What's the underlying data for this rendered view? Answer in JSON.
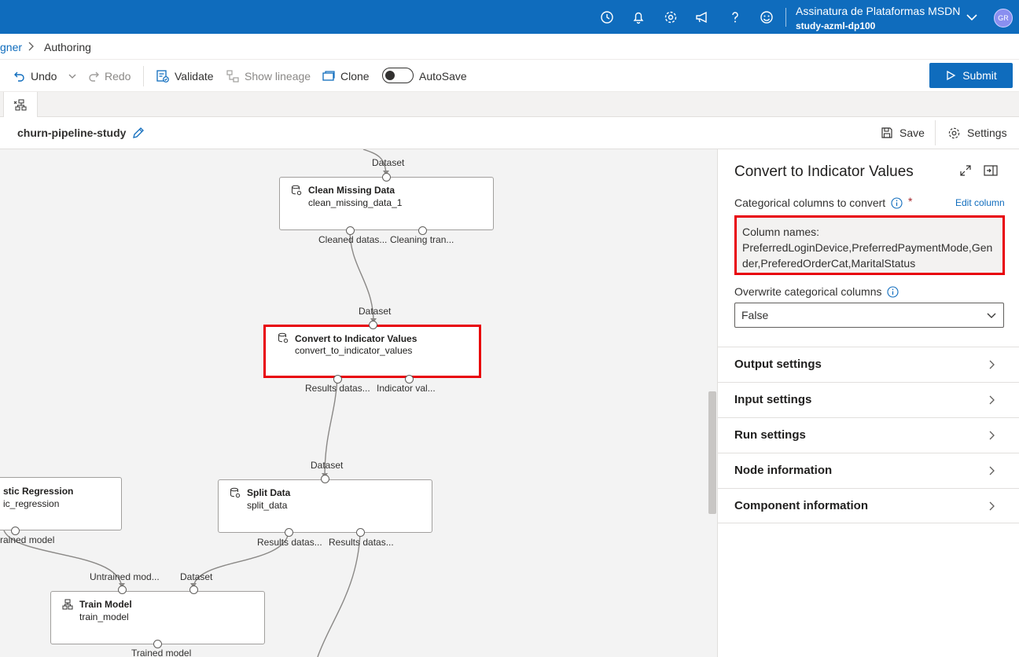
{
  "topbar": {
    "icons": [
      "history-icon",
      "bell-icon",
      "gear-icon",
      "feedback-icon",
      "help-icon",
      "smiley-icon"
    ],
    "account_name": "Assinatura de Plataformas MSDN",
    "workspace": "study-azml-dp100",
    "avatar_initials": "GR",
    "accent": "#0f6cbd"
  },
  "breadcrumb": {
    "parent": "gner",
    "current": "Authoring"
  },
  "toolbar": {
    "undo": "Undo",
    "redo": "Redo",
    "validate": "Validate",
    "show_lineage": "Show lineage",
    "clone": "Clone",
    "autosave": "AutoSave",
    "autosave_on": false,
    "submit": "Submit"
  },
  "pipeline": {
    "name": "churn-pipeline-study",
    "save": "Save",
    "settings": "Settings"
  },
  "canvas": {
    "nodes": {
      "clean": {
        "title": "Clean Missing Data",
        "sub": "clean_missing_data_1",
        "in": [
          "Dataset"
        ],
        "out": [
          "Cleaned datas...",
          "Cleaning tran..."
        ]
      },
      "convert": {
        "title": "Convert to Indicator Values",
        "sub": "convert_to_indicator_values",
        "in": [
          "Dataset"
        ],
        "out": [
          "Results datas...",
          "Indicator val..."
        ],
        "selected": true
      },
      "logreg": {
        "title": "stic Regression",
        "sub": "ic_regression",
        "out": [
          "rained model"
        ]
      },
      "split": {
        "title": "Split Data",
        "sub": "split_data",
        "in": [
          "Dataset"
        ],
        "out": [
          "Results datas...",
          "Results datas..."
        ]
      },
      "train": {
        "title": "Train Model",
        "sub": "train_model",
        "in": [
          "Untrained mod...",
          "Dataset"
        ],
        "out": [
          "Trained model"
        ]
      }
    },
    "highlight_color": "#e8000a"
  },
  "panel": {
    "title": "Convert to Indicator Values",
    "categorical_label": "Categorical columns to convert",
    "required_mark": "*",
    "edit_column": "Edit column",
    "column_names_label": "Column names:",
    "column_names_value": "PreferredLoginDevice,PreferredPaymentMode,Gender,PreferedOrderCat,MaritalStatus",
    "overwrite_label": "Overwrite categorical columns",
    "overwrite_value": "False",
    "sections": [
      "Output settings",
      "Input settings",
      "Run settings",
      "Node information",
      "Component information"
    ]
  }
}
